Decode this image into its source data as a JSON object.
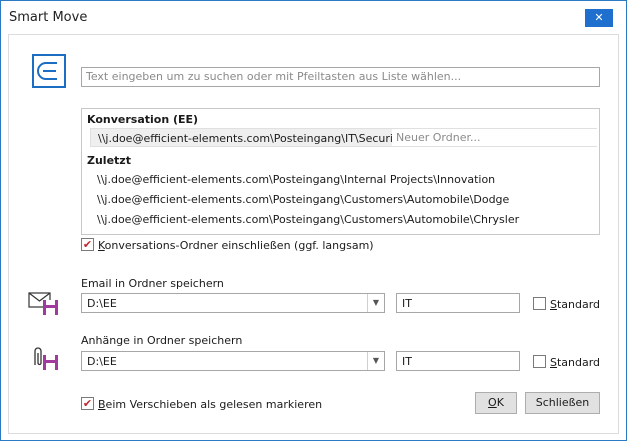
{
  "window": {
    "title": "Smart Move",
    "close_glyph": "✕"
  },
  "search": {
    "placeholder": "Text eingeben um zu suchen oder mit Pfeiltasten aus Liste wählen..."
  },
  "conversation": {
    "header": "Konversation (EE)",
    "path": "\\\\j.doe@efficient-elements.com\\Posteingang\\IT\\Security\\",
    "new_folder_placeholder": "Neuer Ordner..."
  },
  "recent": {
    "header": "Zuletzt",
    "items": [
      "\\\\j.doe@efficient-elements.com\\Posteingang\\Internal Projects\\Innovation",
      "\\\\j.doe@efficient-elements.com\\Posteingang\\Customers\\Automobile\\Dodge",
      "\\\\j.doe@efficient-elements.com\\Posteingang\\Customers\\Automobile\\Chrysler"
    ]
  },
  "include_conversation": {
    "label_rest": "onversations-Ordner einschließen (ggf. langsam)",
    "label_accel": "K",
    "checked": true
  },
  "email_save": {
    "label": "Email in Ordner speichern",
    "folder_value": "D:\\EE",
    "subfolder_value": "IT",
    "standard_accel": "S",
    "standard_rest": "tandard",
    "standard_checked": false,
    "icon": "envelope-save-icon"
  },
  "attachments_save": {
    "label": "Anhänge in Ordner speichern",
    "folder_value": "D:\\EE",
    "subfolder_value": "IT",
    "standard_accel": "S",
    "standard_rest": "tandard",
    "standard_checked": false,
    "icon": "paperclip-save-icon"
  },
  "mark_read": {
    "label_accel": "B",
    "label_rest": "eim Verschieben als gelesen markieren",
    "checked": true
  },
  "buttons": {
    "ok_accel": "O",
    "ok_rest": "K",
    "close_label": "Schließen"
  },
  "colors": {
    "accent": "#1b6ec2",
    "check": "#c0282f",
    "floppy": "#a03a9c"
  }
}
